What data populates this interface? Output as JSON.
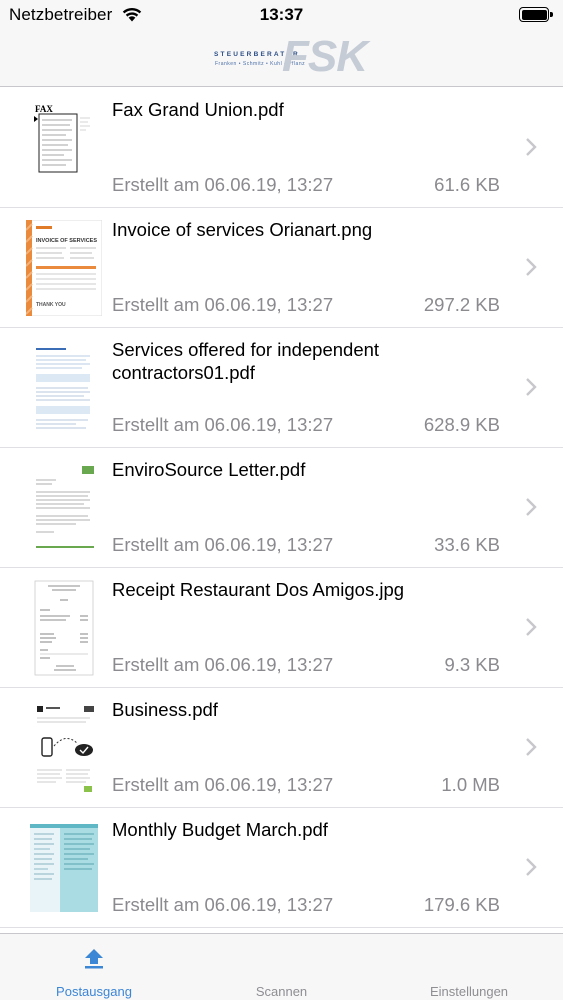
{
  "status_bar": {
    "carrier": "Netzbetreiber",
    "time": "13:37",
    "battery_level": 1.0
  },
  "header": {
    "logo_top": "STEUERBERATER",
    "logo_names": "Franken • Schmitz • Kuhl • Pflanz",
    "logo_mark": "FSK"
  },
  "documents": [
    {
      "name": "Fax Grand Union.pdf",
      "date": "Erstellt am 06.06.19, 13:27",
      "size": "61.6 KB",
      "thumb": "fax-thumbnail"
    },
    {
      "name": "Invoice of services Orianart.png",
      "date": "Erstellt am 06.06.19, 13:27",
      "size": "297.2 KB",
      "thumb": "invoice-thumbnail"
    },
    {
      "name": "Services offered for independent contractors01.pdf",
      "date": "Erstellt am 06.06.19, 13:27",
      "size": "628.9 KB",
      "thumb": "services-thumbnail"
    },
    {
      "name": "EnviroSource Letter.pdf",
      "date": "Erstellt am 06.06.19, 13:27",
      "size": "33.6 KB",
      "thumb": "letter-thumbnail"
    },
    {
      "name": "Receipt Restaurant Dos Amigos.jpg",
      "date": "Erstellt am 06.06.19, 13:27",
      "size": "9.3 KB",
      "thumb": "receipt-thumbnail"
    },
    {
      "name": "Business.pdf",
      "date": "Erstellt am 06.06.19, 13:27",
      "size": "1.0 MB",
      "thumb": "business-thumbnail"
    },
    {
      "name": "Monthly Budget March.pdf",
      "date": "Erstellt am 06.06.19, 13:27",
      "size": "179.6 KB",
      "thumb": "budget-thumbnail"
    }
  ],
  "tabs": [
    {
      "label": "Postausgang",
      "icon": "upload-arrow-icon",
      "active": true
    },
    {
      "label": "Scannen",
      "icon": "scan-icon",
      "active": false
    },
    {
      "label": "Einstellungen",
      "icon": "settings-icon",
      "active": false
    }
  ],
  "colors": {
    "accent": "#3c86d6",
    "secondary_text": "#8a8a8f",
    "bar_background": "#f7f7f7"
  }
}
